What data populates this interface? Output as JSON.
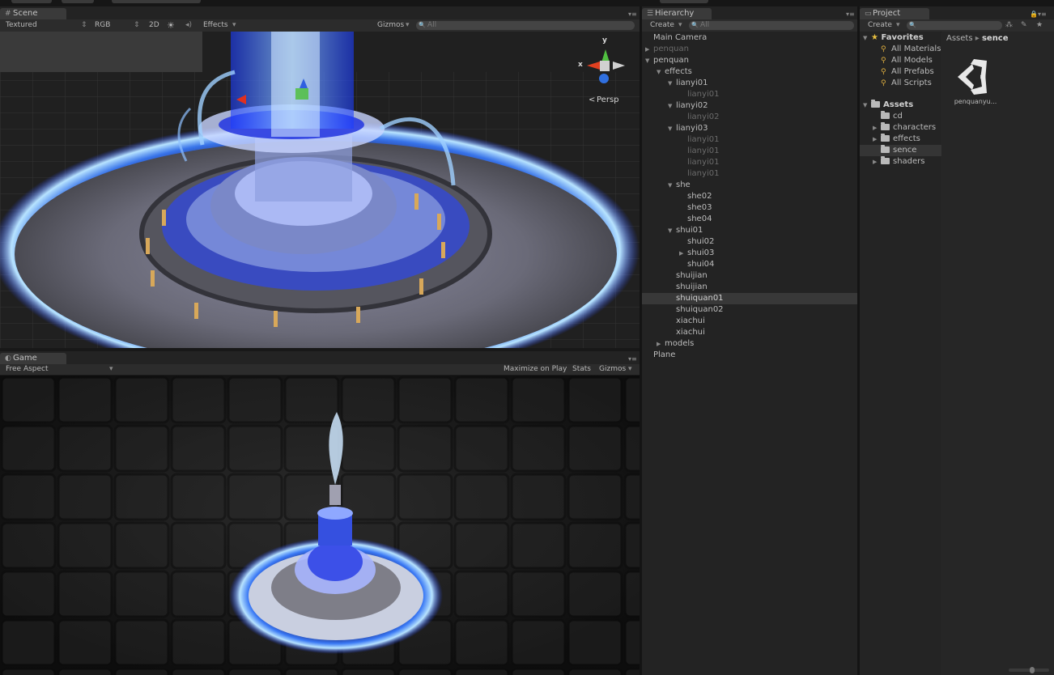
{
  "scene_panel": {
    "tab_label": "Scene",
    "toolbar": {
      "shading_mode": "Textured",
      "render_mode": "RGB",
      "mode_2d": "2D",
      "effects_label": "Effects",
      "gizmos_label": "Gizmos",
      "search_placeholder": "All"
    },
    "gizmo": {
      "axis_x": "x",
      "axis_y": "y",
      "projection": "Persp"
    }
  },
  "game_panel": {
    "tab_label": "Game",
    "aspect": "Free Aspect",
    "maximize_on_play": "Maximize on Play",
    "stats": "Stats",
    "gizmos": "Gizmos"
  },
  "hierarchy": {
    "tab_label": "Hierarchy",
    "create_label": "Create",
    "search_placeholder": "All",
    "items": [
      {
        "label": "Main Camera",
        "depth": 0,
        "arrow": "",
        "dim": false
      },
      {
        "label": "penquan",
        "depth": 0,
        "arrow": "▶",
        "dim": true
      },
      {
        "label": "penquan",
        "depth": 0,
        "arrow": "▼",
        "dim": false
      },
      {
        "label": "effects",
        "depth": 1,
        "arrow": "▼",
        "dim": false
      },
      {
        "label": "lianyi01",
        "depth": 2,
        "arrow": "▼",
        "dim": false
      },
      {
        "label": "lianyi01",
        "depth": 3,
        "arrow": "",
        "dim": true
      },
      {
        "label": "lianyi02",
        "depth": 2,
        "arrow": "▼",
        "dim": false
      },
      {
        "label": "lianyi02",
        "depth": 3,
        "arrow": "",
        "dim": true
      },
      {
        "label": "lianyi03",
        "depth": 2,
        "arrow": "▼",
        "dim": false
      },
      {
        "label": "lianyi01",
        "depth": 3,
        "arrow": "",
        "dim": true
      },
      {
        "label": "lianyi01",
        "depth": 3,
        "arrow": "",
        "dim": true
      },
      {
        "label": "lianyi01",
        "depth": 3,
        "arrow": "",
        "dim": true
      },
      {
        "label": "lianyi01",
        "depth": 3,
        "arrow": "",
        "dim": true
      },
      {
        "label": "she",
        "depth": 2,
        "arrow": "▼",
        "dim": false
      },
      {
        "label": "she02",
        "depth": 3,
        "arrow": "",
        "dim": false
      },
      {
        "label": "she03",
        "depth": 3,
        "arrow": "",
        "dim": false
      },
      {
        "label": "she04",
        "depth": 3,
        "arrow": "",
        "dim": false
      },
      {
        "label": "shui01",
        "depth": 2,
        "arrow": "▼",
        "dim": false
      },
      {
        "label": "shui02",
        "depth": 3,
        "arrow": "",
        "dim": false
      },
      {
        "label": "shui03",
        "depth": 3,
        "arrow": "▶",
        "dim": false
      },
      {
        "label": "shui04",
        "depth": 3,
        "arrow": "",
        "dim": false
      },
      {
        "label": "shuijian",
        "depth": 2,
        "arrow": "",
        "dim": false
      },
      {
        "label": "shuijian",
        "depth": 2,
        "arrow": "",
        "dim": false
      },
      {
        "label": "shuiquan01",
        "depth": 2,
        "arrow": "",
        "dim": false,
        "selected": true
      },
      {
        "label": "shuiquan02",
        "depth": 2,
        "arrow": "",
        "dim": false
      },
      {
        "label": "xiachui",
        "depth": 2,
        "arrow": "",
        "dim": false
      },
      {
        "label": "xiachui",
        "depth": 2,
        "arrow": "",
        "dim": false
      },
      {
        "label": "models",
        "depth": 1,
        "arrow": "▶",
        "dim": false
      },
      {
        "label": "Plane",
        "depth": 0,
        "arrow": "",
        "dim": false
      }
    ]
  },
  "project": {
    "tab_label": "Project",
    "create_label": "Create",
    "breadcrumb_root": "Assets",
    "breadcrumb_sep": "▸",
    "breadcrumb_current": "sence",
    "favorites_label": "Favorites",
    "favorites": [
      "All Materials",
      "All Models",
      "All Prefabs",
      "All Scripts"
    ],
    "assets_label": "Assets",
    "folders": [
      {
        "label": "cd",
        "arrow": ""
      },
      {
        "label": "characters",
        "arrow": "▶"
      },
      {
        "label": "effects",
        "arrow": "▶"
      },
      {
        "label": "sence",
        "arrow": "",
        "selected": true
      },
      {
        "label": "shaders",
        "arrow": "▶"
      }
    ],
    "asset_item": "penquanyu..."
  }
}
